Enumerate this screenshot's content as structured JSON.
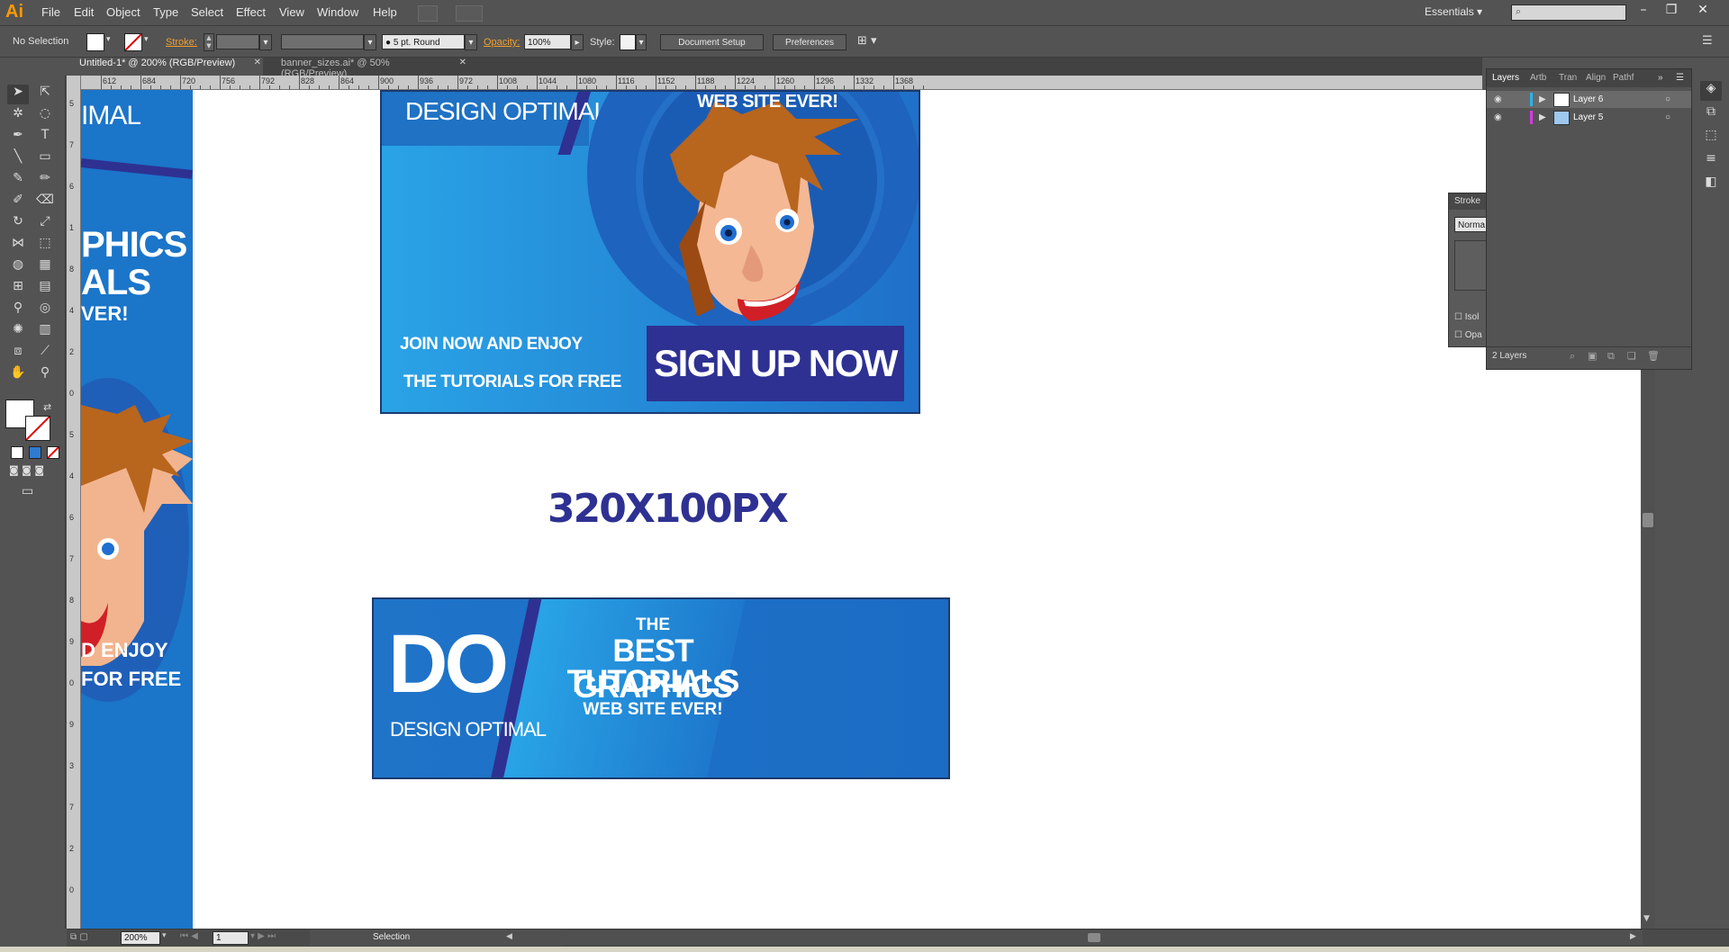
{
  "app": {
    "logo": "Ai"
  },
  "menu": [
    "File",
    "Edit",
    "Object",
    "Type",
    "Select",
    "Effect",
    "View",
    "Window",
    "Help"
  ],
  "workspace": {
    "label": "Essentials"
  },
  "control_bar": {
    "selection": "No Selection",
    "stroke_label": "Stroke:",
    "brush": "5 pt. Round",
    "opacity_label": "Opacity:",
    "opacity_value": "100%",
    "style_label": "Style:",
    "document_setup": "Document Setup",
    "preferences": "Preferences"
  },
  "tabs": [
    {
      "label": "Untitled-1* @ 200% (RGB/Preview)",
      "active": true
    },
    {
      "label": "banner_sizes.ai* @ 50% (RGB/Preview)",
      "active": false
    }
  ],
  "ruler": {
    "h_labels": [
      "612",
      "684",
      "720",
      "756",
      "792",
      "828",
      "864",
      "900",
      "936",
      "972",
      "1008",
      "1044",
      "1080",
      "1116",
      "1152",
      "1188",
      "1224",
      "1260",
      "1296",
      "1332",
      "1368"
    ],
    "v_labels": [
      "5",
      "7",
      "6",
      "1",
      "8",
      "4",
      "2",
      "0",
      "5",
      "4",
      "6",
      "7",
      "8",
      "9",
      "0",
      "9",
      "3",
      "7",
      "2",
      "0"
    ]
  },
  "canvas": {
    "left_strip": {
      "brand": "IMAL",
      "line1": "PHICS",
      "line2": "ALS",
      "line3": "VER!",
      "line4": "D ENJOY",
      "line5": "FOR FREE"
    },
    "banner_top": {
      "brand": "DESIGN OPTIMAL",
      "headline_tail": "WEB SITE EVER!",
      "line1": "JOIN NOW AND ENJOY",
      "line2": "THE TUTORIALS FOR FREE",
      "cta": "SIGN UP NOW"
    },
    "size_label": "320X100PX",
    "banner_bottom": {
      "logo": "DO",
      "brand": "DESIGN OPTIMAL",
      "the": "THE",
      "line1": "BEST GRAPHICS",
      "line2": "TUTORIALS",
      "line3": "WEB SITE EVER!"
    }
  },
  "layers_panel": {
    "tabs": [
      "Layers",
      "Artb",
      "Tran",
      "Align",
      "Pathf"
    ],
    "layers": [
      {
        "name": "Layer 6",
        "color": "#29b5e8",
        "selected": true
      },
      {
        "name": "Layer 5",
        "color": "#d43be0",
        "selected": false
      }
    ],
    "count": "2 Layers"
  },
  "stroke_panel": {
    "title": "Stroke",
    "blend": "Norma",
    "isolate": "Isol",
    "opacity": "Opa"
  },
  "status": {
    "zoom": "200%",
    "artboard": "1",
    "tool": "Selection"
  },
  "colors": {
    "banner_blue": "#1b75c9",
    "banner_light": "#2aa3e6",
    "navy": "#2e3192",
    "cta_bg": "#2e3192",
    "ui_bg": "#535353"
  }
}
